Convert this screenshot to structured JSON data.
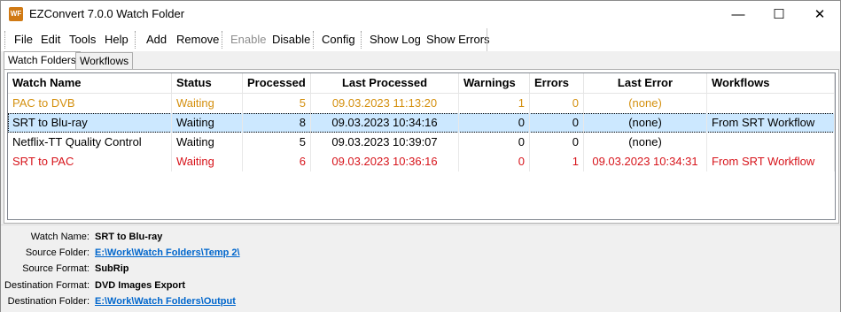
{
  "window": {
    "title": "EZConvert 7.0.0 Watch Folder",
    "icon_text": "WF"
  },
  "titlebar_buttons": {
    "minimize": "—",
    "maximize": "☐",
    "close": "✕"
  },
  "menu": {
    "file": "File",
    "edit": "Edit",
    "tools": "Tools",
    "help": "Help"
  },
  "toolbar": {
    "add": "Add",
    "remove": "Remove",
    "enable": "Enable",
    "disable": "Disable",
    "config": "Config",
    "show_log": "Show Log",
    "show_errors": "Show Errors"
  },
  "tabs": [
    {
      "label": "Watch Folders"
    },
    {
      "label": "Workflows"
    }
  ],
  "table": {
    "headers": [
      "Watch Name",
      "Status",
      "Processed",
      "Last Processed",
      "Warnings",
      "Errors",
      "Last Error",
      "Workflows"
    ],
    "rows": [
      {
        "name": "PAC to DVB",
        "status": "Waiting",
        "processed": "5",
        "last_processed": "09.03.2023  11:13:20",
        "warnings": "1",
        "errors": "0",
        "last_error": "(none)",
        "workflows": "",
        "color": "#d4900f"
      },
      {
        "name": "SRT to Blu-ray",
        "status": "Waiting",
        "processed": "8",
        "last_processed": "09.03.2023  10:34:16",
        "warnings": "0",
        "errors": "0",
        "last_error": "(none)",
        "workflows": "From SRT Workflow",
        "color": "#000000"
      },
      {
        "name": "Netflix-TT Quality Control",
        "status": "Waiting",
        "processed": "5",
        "last_processed": "09.03.2023  10:39:07",
        "warnings": "0",
        "errors": "0",
        "last_error": "(none)",
        "workflows": "",
        "color": "#000000"
      },
      {
        "name": "SRT to PAC",
        "status": "Waiting",
        "processed": "6",
        "last_processed": "09.03.2023  10:36:16",
        "warnings": "0",
        "errors": "1",
        "last_error": "09.03.2023  10:34:31",
        "workflows": "From SRT Workflow",
        "color": "#d7141b"
      }
    ]
  },
  "details": {
    "watch_name_label": "Watch Name:",
    "watch_name": "SRT to Blu-ray",
    "source_folder_label": "Source Folder:",
    "source_folder": "E:\\Work\\Watch Folders\\Temp 2\\",
    "source_format_label": "Source Format:",
    "source_format": "SubRip",
    "dest_format_label": "Destination Format:",
    "dest_format": "DVD Images Export",
    "dest_folder_label": "Destination Folder:",
    "dest_folder": "E:\\Work\\Watch Folders\\Output"
  }
}
